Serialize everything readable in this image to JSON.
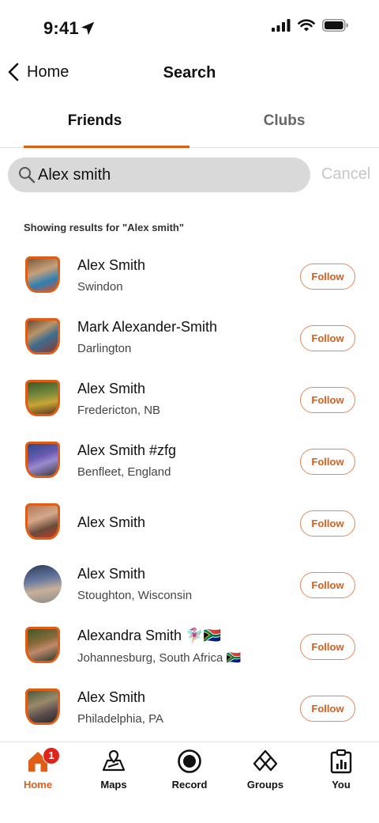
{
  "status_bar": {
    "time": "9:41"
  },
  "nav": {
    "back_label": "Home",
    "title": "Search"
  },
  "tabs": [
    {
      "label": "Friends",
      "active": true
    },
    {
      "label": "Clubs",
      "active": false
    }
  ],
  "search": {
    "value": "Alex smith",
    "placeholder": "Search",
    "cancel_label": "Cancel"
  },
  "results_caption": "Showing results for \"Alex smith\"",
  "follow_label": "Follow",
  "results": [
    {
      "name": "Alex Smith",
      "location": "Swindon",
      "avatar_shape": "shield"
    },
    {
      "name": "Mark Alexander-Smith",
      "location": "Darlington",
      "avatar_shape": "shield"
    },
    {
      "name": "Alex Smith",
      "location": "Fredericton, NB",
      "avatar_shape": "shield"
    },
    {
      "name": "Alex Smith #zfg",
      "location": "Benfleet, England",
      "avatar_shape": "shield"
    },
    {
      "name": "Alex Smith",
      "location": "",
      "avatar_shape": "shield"
    },
    {
      "name": "Alex Smith",
      "location": "Stoughton, Wisconsin",
      "avatar_shape": "circle"
    },
    {
      "name": "Alexandra  Smith 🧚🏼‍♀️🇿🇦",
      "location": "Johannesburg, South Africa 🇿🇦",
      "avatar_shape": "shield"
    },
    {
      "name": "Alex Smith",
      "location": "Philadelphia, PA",
      "avatar_shape": "shield"
    }
  ],
  "tab_bar": {
    "items": [
      {
        "label": "Home",
        "icon": "home-icon",
        "active": true,
        "badge": "1"
      },
      {
        "label": "Maps",
        "icon": "map-icon",
        "active": false
      },
      {
        "label": "Record",
        "icon": "record-icon",
        "active": false
      },
      {
        "label": "Groups",
        "icon": "groups-icon",
        "active": false
      },
      {
        "label": "You",
        "icon": "clipboard-icon",
        "active": false
      }
    ]
  },
  "colors": {
    "accent": "#e05d15",
    "badge": "#e2231a",
    "search_bg": "#d9d9d9"
  }
}
